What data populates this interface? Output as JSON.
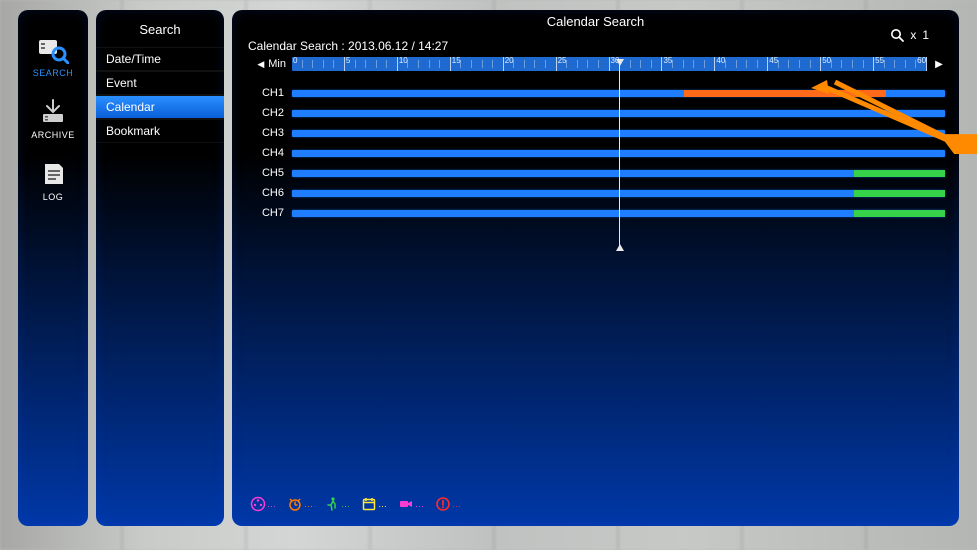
{
  "rail": {
    "items": [
      {
        "id": "search",
        "label": "SEARCH",
        "active": true
      },
      {
        "id": "archive",
        "label": "ARCHIVE",
        "active": false
      },
      {
        "id": "log",
        "label": "LOG",
        "active": false
      }
    ]
  },
  "menu": {
    "title": "Search",
    "items": [
      {
        "label": "Date/Time",
        "selected": false
      },
      {
        "label": "Event",
        "selected": false
      },
      {
        "label": "Calendar",
        "selected": true
      },
      {
        "label": "Bookmark",
        "selected": false
      }
    ]
  },
  "main": {
    "title": "Calendar Search",
    "zoom_prefix": "x",
    "zoom_level": "1",
    "timestamp": "Calendar Search : 2013.06.12 / 14:27",
    "ruler": {
      "unit": "Min",
      "labels": [
        "0",
        "5",
        "10",
        "15",
        "20",
        "25",
        "30",
        "35",
        "40",
        "45",
        "50",
        "55",
        "60"
      ]
    },
    "channels": [
      {
        "name": "CH1",
        "segments": [
          {
            "type": "orange",
            "start_pct": 60,
            "end_pct": 91
          }
        ]
      },
      {
        "name": "CH2",
        "segments": []
      },
      {
        "name": "CH3",
        "segments": []
      },
      {
        "name": "CH4",
        "segments": []
      },
      {
        "name": "CH5",
        "segments": [
          {
            "type": "green",
            "start_pct": 86,
            "end_pct": 100
          }
        ]
      },
      {
        "name": "CH6",
        "segments": [
          {
            "type": "green",
            "start_pct": 86,
            "end_pct": 100
          }
        ]
      },
      {
        "name": "CH7",
        "segments": [
          {
            "type": "green",
            "start_pct": 86,
            "end_pct": 100
          }
        ]
      }
    ],
    "playhead_pct": 50,
    "legend": [
      {
        "id": "continuous",
        "color": "#ff3bd4"
      },
      {
        "id": "alarm",
        "color": "#ff7a00"
      },
      {
        "id": "motion",
        "color": "#35d24a"
      },
      {
        "id": "schedule",
        "color": "#ffe83b"
      },
      {
        "id": "audio",
        "color": "#ff3bd4"
      },
      {
        "id": "panic",
        "color": "#ff2a2a"
      }
    ]
  }
}
